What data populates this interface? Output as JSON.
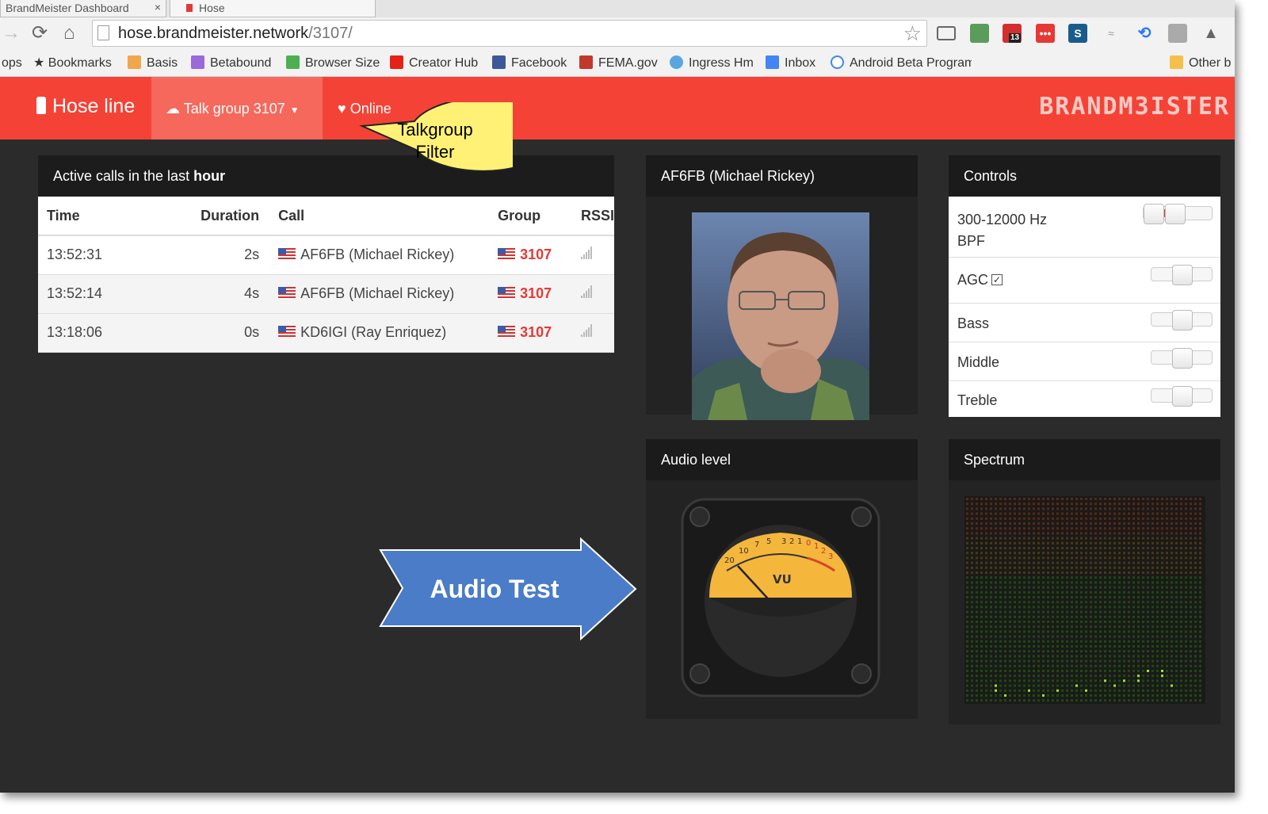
{
  "browser": {
    "tabs": [
      "BrandMeister Dashboard",
      "Hose"
    ],
    "url_host": "hose.brandmeister.network",
    "url_path": "/3107/",
    "ext_badge": "13",
    "bookmarks": [
      {
        "label": "ops",
        "icon": "apps-icon",
        "color": "#888"
      },
      {
        "label": "Bookmarks",
        "icon": "star-icon",
        "color": "#555"
      },
      {
        "label": "Basis",
        "icon": "basis-icon",
        "color": "#f0a64a"
      },
      {
        "label": "Betabound",
        "icon": "betabound-icon",
        "color": "#9b6ad9"
      },
      {
        "label": "Browser Size",
        "icon": "browser-size-icon",
        "color": "#4caf50"
      },
      {
        "label": "Creator Hub",
        "icon": "youtube-icon",
        "color": "#e62117"
      },
      {
        "label": "Facebook",
        "icon": "facebook-icon",
        "color": "#3b5998"
      },
      {
        "label": "FEMA.gov",
        "icon": "fema-icon",
        "color": "#c0392b"
      },
      {
        "label": "Ingress Hm",
        "icon": "ingress-icon",
        "color": "#5aa6e0"
      },
      {
        "label": "Inbox",
        "icon": "inbox-icon",
        "color": "#4285f4"
      },
      {
        "label": "Android Beta Program",
        "icon": "google-icon",
        "color": "#4285f4"
      }
    ],
    "other_bookmarks": "Other b"
  },
  "nav": {
    "brand": "Hose line",
    "talkgroup": "Talk group 3107",
    "online": "Online",
    "logo": "BRANDM3ISTER"
  },
  "calls": {
    "title_prefix": "Active calls in the last",
    "title_bold": "hour",
    "headers": [
      "Time",
      "Duration",
      "Call",
      "Group",
      "RSSI"
    ],
    "rows": [
      {
        "time": "13:52:31",
        "duration": "2s",
        "call": "AF6FB (Michael Rickey)",
        "group": "3107"
      },
      {
        "time": "13:52:14",
        "duration": "4s",
        "call": "AF6FB (Michael Rickey)",
        "group": "3107"
      },
      {
        "time": "13:18:06",
        "duration": "0s",
        "call": "KD6IGI (Ray Enriquez)",
        "group": "3107"
      }
    ]
  },
  "profile": {
    "title": "AF6FB (Michael Rickey)"
  },
  "controls": {
    "title": "Controls",
    "items": [
      {
        "label": "300-12000 Hz BPF"
      },
      {
        "label": "AGC"
      },
      {
        "label": "Bass"
      },
      {
        "label": "Middle"
      },
      {
        "label": "Treble"
      }
    ],
    "agc_checked": true
  },
  "audio": {
    "title": "Audio level",
    "meter_label": "VU",
    "scale": [
      "20",
      "10",
      "7",
      "5",
      "3",
      "2",
      "1",
      "0",
      "1",
      "2",
      "3"
    ]
  },
  "spectrum": {
    "title": "Spectrum"
  },
  "annotations": {
    "bubble_line1": "Talkgroup",
    "bubble_line2": "Filter",
    "arrow": "Audio Test"
  },
  "colors": {
    "accent": "#f44336",
    "group": "#e53935",
    "arrow": "#4a7cc7",
    "bubble": "#fff176"
  }
}
